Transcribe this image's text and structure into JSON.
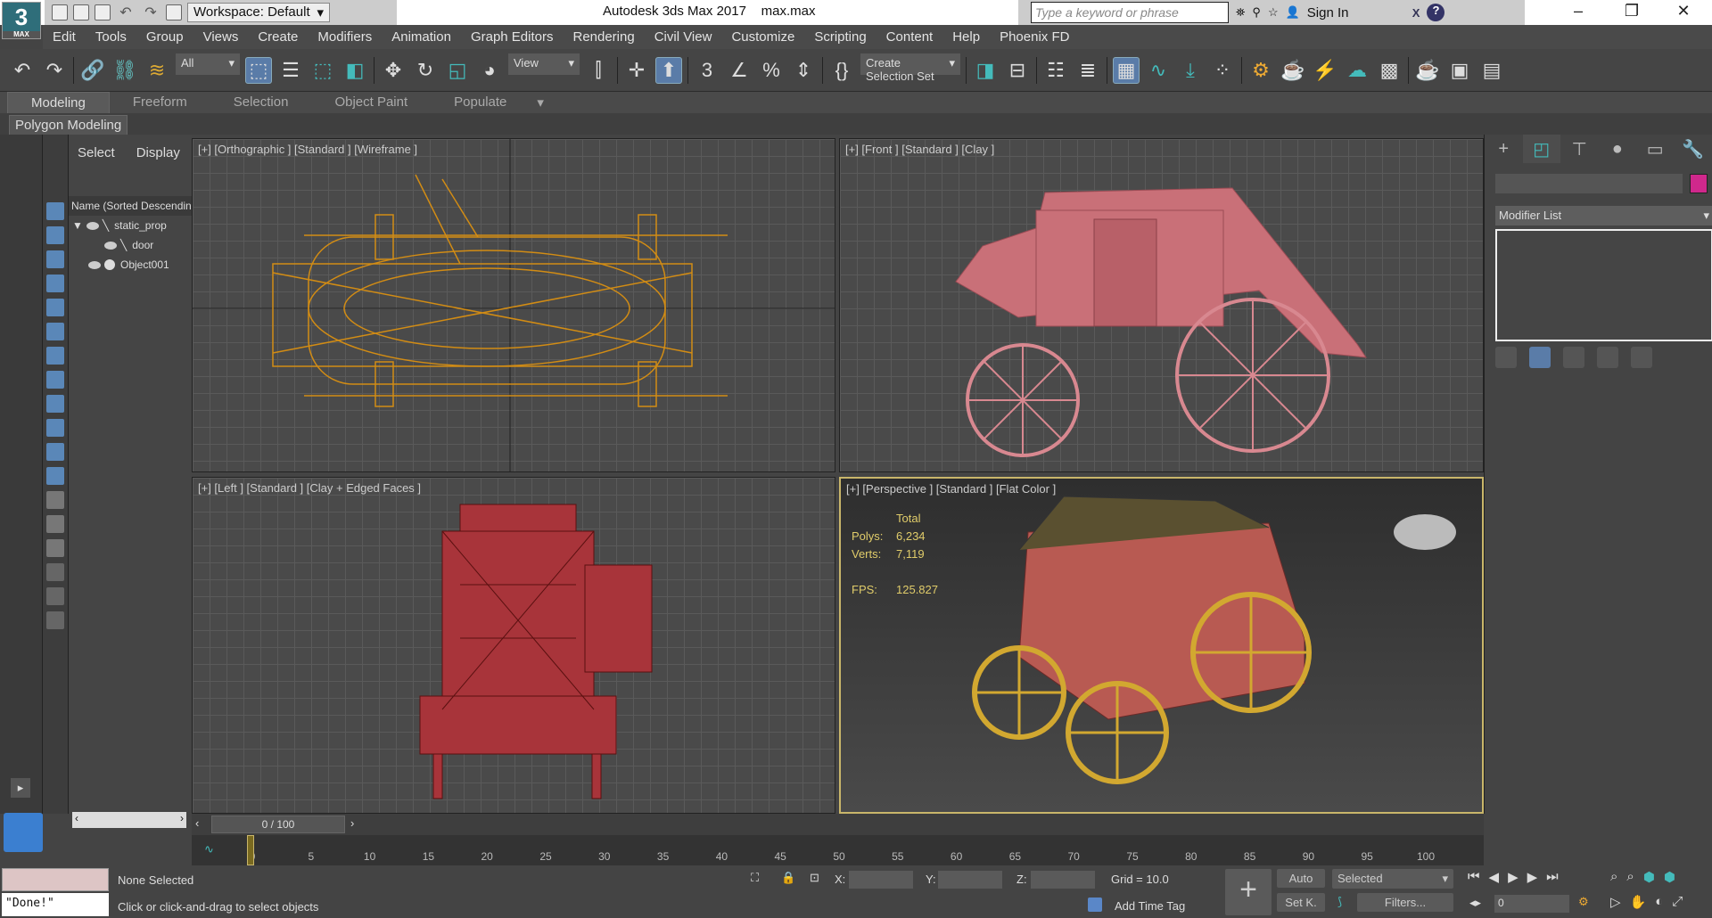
{
  "titlebar": {
    "app_title": "Autodesk 3ds Max 2017",
    "file_name": "max.max",
    "workspace": "Workspace: Default",
    "search_placeholder": "Type a keyword or phrase",
    "sign_in": "Sign In",
    "logo": "3",
    "logo_sub": "MAX"
  },
  "menu": [
    "Edit",
    "Tools",
    "Group",
    "Views",
    "Create",
    "Modifiers",
    "Animation",
    "Graph Editors",
    "Rendering",
    "Civil View",
    "Customize",
    "Scripting",
    "Content",
    "Help",
    "Phoenix FD"
  ],
  "toolbar": {
    "filter": "All",
    "ref_coord": "View",
    "selection_set": "Create Selection Set"
  },
  "ribbon": {
    "tabs": [
      "Modeling",
      "Freeform",
      "Selection",
      "Object Paint",
      "Populate"
    ],
    "panel": "Polygon Modeling"
  },
  "explorer": {
    "tabs": [
      "Select",
      "Display"
    ],
    "column_header": "Name (Sorted Descending)",
    "items": [
      "static_prop",
      "door",
      "Object001"
    ]
  },
  "viewports": {
    "top_left": "[+] [Orthographic ] [Standard ] [Wireframe ]",
    "top_right": "[+] [Front ] [Standard ] [Clay ]",
    "bottom_left": "[+] [Left ] [Standard ] [Clay + Edged Faces ]",
    "bottom_right": "[+] [Perspective ] [Standard ] [Flat Color ]"
  },
  "stats": {
    "header": "Total",
    "polys_label": "Polys:",
    "polys": "6,234",
    "verts_label": "Verts:",
    "verts": "7,119",
    "fps_label": "FPS:",
    "fps": "125.827"
  },
  "command_panel": {
    "modifier_list": "Modifier List",
    "object_color": "#d0288c"
  },
  "timeline": {
    "frame_display": "0 / 100",
    "current_frame": 0,
    "ticks": [
      "0",
      "5",
      "10",
      "15",
      "20",
      "25",
      "30",
      "35",
      "40",
      "45",
      "50",
      "55",
      "60",
      "65",
      "70",
      "75",
      "80",
      "85",
      "90",
      "95",
      "100"
    ]
  },
  "status": {
    "maxscript_output": "\"Done!\"",
    "selection": "None Selected",
    "prompt": "Click or click-and-drag to select objects",
    "x_label": "X:",
    "y_label": "Y:",
    "z_label": "Z:",
    "grid": "Grid = 10.0",
    "add_time_tag": "Add Time Tag",
    "auto_key": "Auto",
    "set_key": "Set K.",
    "key_filter_select": "Selected",
    "filters": "Filters...",
    "frame_field": "0"
  }
}
